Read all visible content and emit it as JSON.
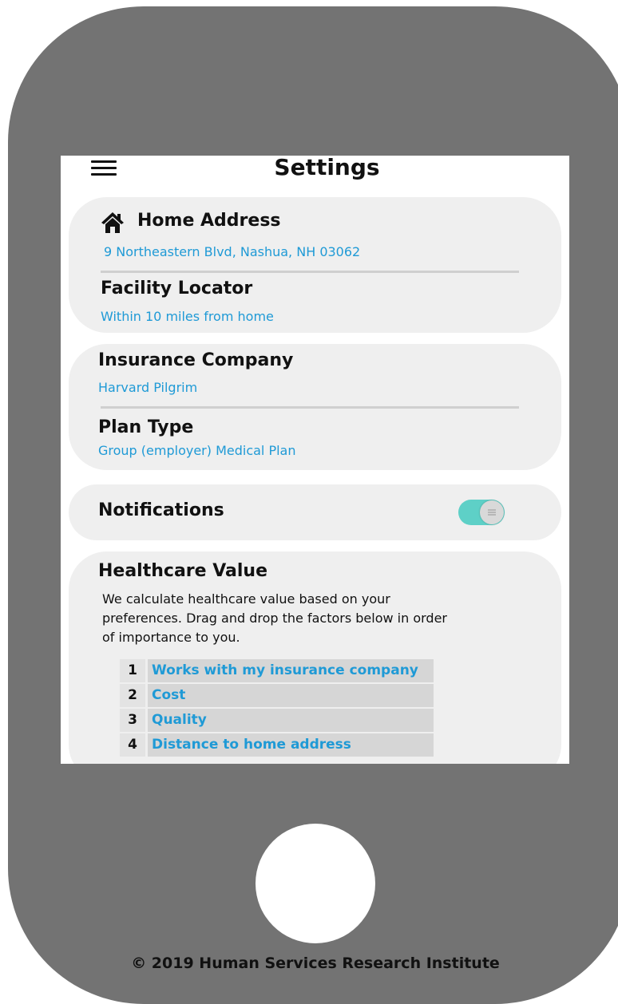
{
  "header": {
    "title": "Settings",
    "menu_icon": "hamburger-menu-icon"
  },
  "location": {
    "home_icon": "home-icon",
    "home_address_label": "Home Address",
    "home_address_value": "9 Northeastern Blvd, Nashua, NH 03062",
    "facility_locator_label": "Facility Locator",
    "facility_locator_value": "Within 10 miles from home"
  },
  "insurance": {
    "company_label": "Insurance Company",
    "company_value": "Harvard Pilgrim",
    "plan_type_label": "Plan Type",
    "plan_type_value": "Group (employer) Medical Plan"
  },
  "notifications": {
    "label": "Notifications",
    "enabled": true,
    "toggle_color": "#5ed0c7"
  },
  "healthcare_value": {
    "title": "Healthcare Value",
    "description": "We calculate healthcare value based on your preferences. Drag and drop the factors below in order of importance to you.",
    "factors": [
      {
        "rank": "1",
        "label": "Works with my insurance company"
      },
      {
        "rank": "2",
        "label": "Cost"
      },
      {
        "rank": "3",
        "label": "Quality"
      },
      {
        "rank": "4",
        "label": "Distance to home address"
      }
    ]
  },
  "footer": {
    "copyright": "© 2019 Human Services Research Institute"
  },
  "colors": {
    "accent": "#1f9ad6",
    "phone_body": "#737373",
    "card_background": "#efefef"
  }
}
